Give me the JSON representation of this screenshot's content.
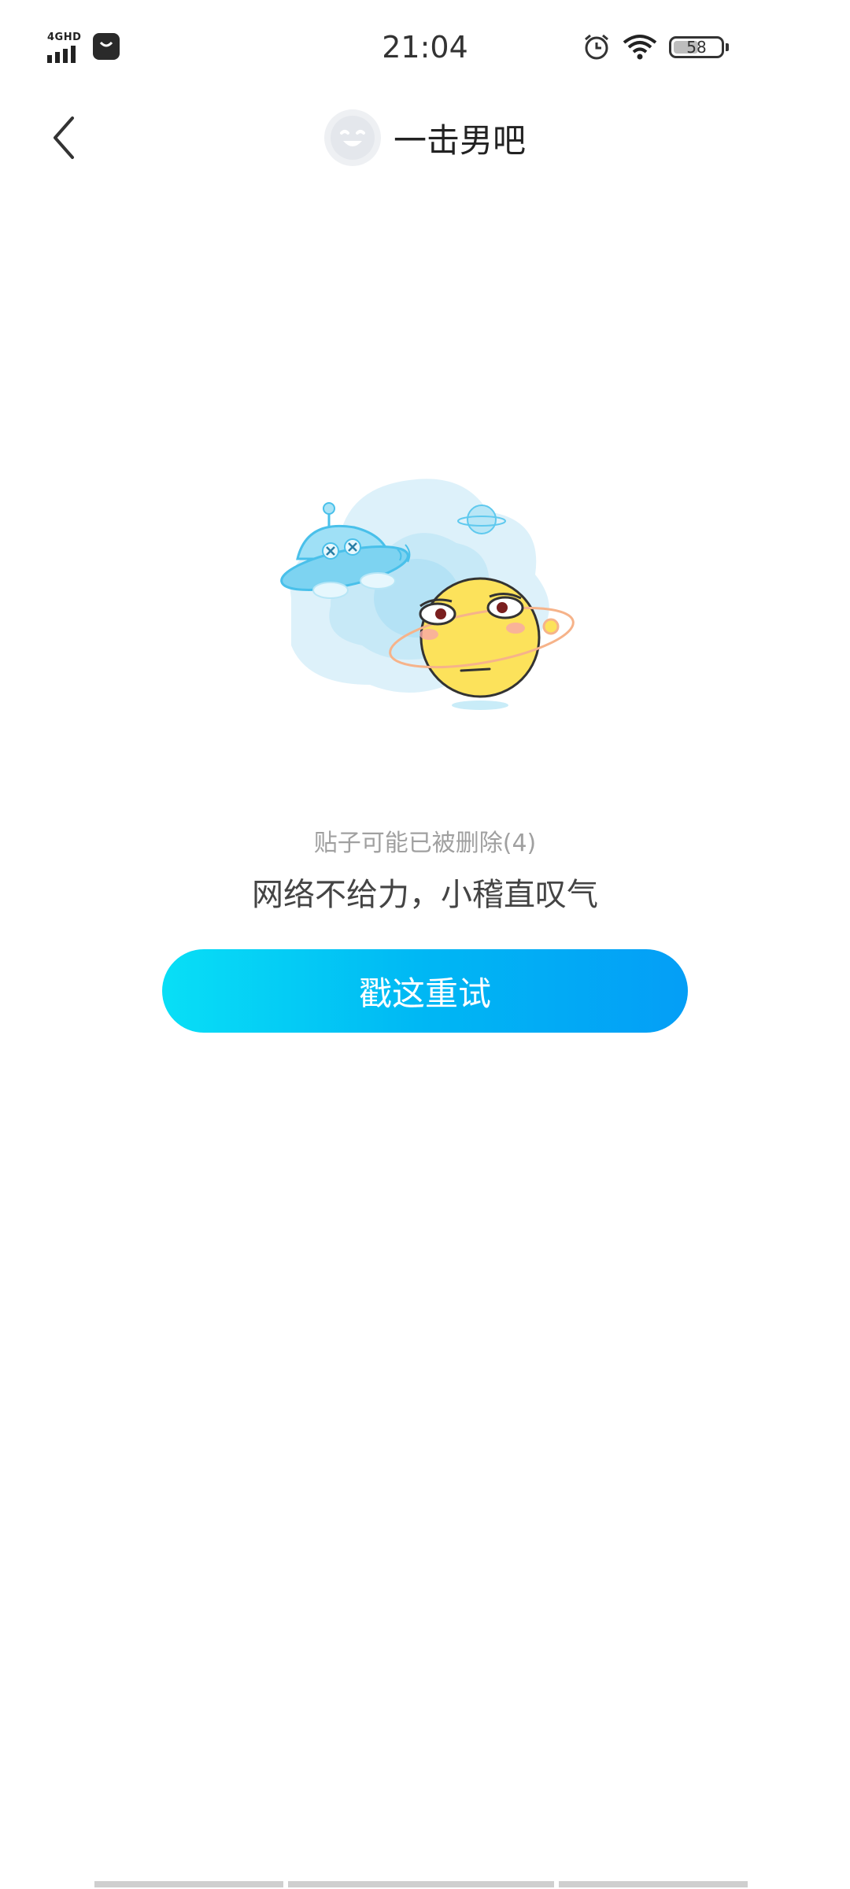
{
  "status_bar": {
    "network": "4GHD",
    "time": "21:04",
    "battery_percent": 58,
    "battery_label": "58",
    "icons": [
      "signal-icon",
      "store-icon",
      "alarm-icon",
      "wifi-icon",
      "battery-icon"
    ]
  },
  "header": {
    "title": "一击男吧",
    "back_icon": "chevron-left-icon",
    "avatar_icon": "laughing-face-avatar"
  },
  "content": {
    "sub_message": "贴子可能已被删除(4)",
    "main_message": "网络不给力，小稽直叹气",
    "retry_label": "戳这重试",
    "illustration_icon": "ufo-and-planet-illustration"
  },
  "colors": {
    "retry_gradient_start": "#08dff6",
    "retry_gradient_end": "#049ef6",
    "sub_text": "#a0a0a0",
    "main_text": "#444444"
  }
}
